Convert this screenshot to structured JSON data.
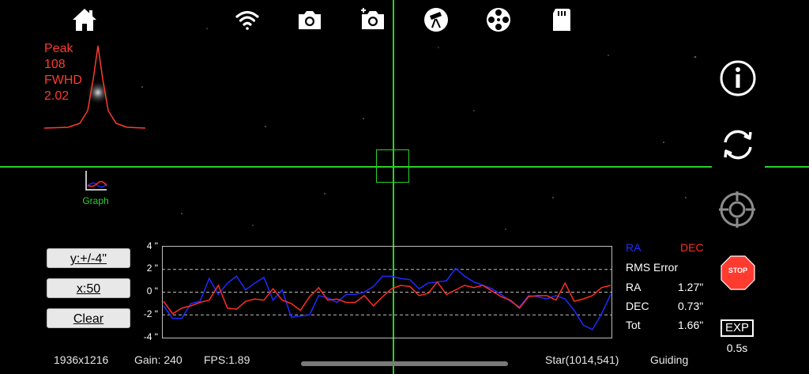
{
  "toolbar": {
    "icons": [
      "home-icon",
      "wifi-icon",
      "camera-icon",
      "camera-settings-icon",
      "telescope-icon",
      "filter-wheel-icon",
      "sd-card-icon",
      "more-icon"
    ]
  },
  "star_profile": {
    "peak_label": "Peak",
    "peak_value": "108",
    "fwhd_label": "FWHD",
    "fwhd_value": "2.02"
  },
  "graph_toggle": {
    "label": "Graph"
  },
  "controls": {
    "y_scale": "y:+/-4\"",
    "x_scale": "x:50",
    "clear": "Clear"
  },
  "chart_data": {
    "type": "line",
    "ylabel": "",
    "ylim": [
      -4,
      4
    ],
    "y_ticks": [
      "4 \"",
      "2 \"",
      "0 \"",
      "-2 \"",
      "-4 \""
    ],
    "x": [
      1,
      2,
      3,
      4,
      5,
      6,
      7,
      8,
      9,
      10,
      11,
      12,
      13,
      14,
      15,
      16,
      17,
      18,
      19,
      20,
      21,
      22,
      23,
      24,
      25,
      26,
      27,
      28,
      29,
      30,
      31,
      32,
      33,
      34,
      35,
      36,
      37,
      38,
      39,
      40,
      41,
      42,
      43,
      44,
      45,
      46,
      47,
      48,
      49,
      50
    ],
    "series": [
      {
        "name": "RA",
        "color": "#1f2bff",
        "values": [
          -1.2,
          -2.3,
          -2.3,
          -1.0,
          -0.8,
          1.2,
          -0.2,
          0.8,
          1.4,
          0.2,
          0.8,
          1.3,
          -0.7,
          0.2,
          -2.2,
          -2.1,
          -2.0,
          -0.3,
          -0.5,
          -0.9,
          -0.2,
          -0.2,
          0.0,
          0.5,
          1.4,
          1.4,
          1.2,
          1.1,
          0.3,
          0.8,
          0.9,
          1.0,
          2.1,
          1.4,
          0.9,
          0.6,
          0.3,
          -0.2,
          -0.8,
          -1.3,
          -0.3,
          -0.4,
          -0.6,
          -0.3,
          -0.6,
          -1.6,
          -2.9,
          -3.3,
          -1.9,
          -0.2
        ]
      },
      {
        "name": "DEC",
        "color": "#ff2d21",
        "values": [
          -0.8,
          -1.9,
          -1.4,
          -1.2,
          -0.9,
          -0.7,
          0.6,
          -1.4,
          -1.5,
          -0.8,
          -0.6,
          -0.7,
          0.3,
          -0.7,
          -1.0,
          -1.6,
          -0.4,
          0.4,
          -0.7,
          -0.6,
          -0.9,
          -0.9,
          -0.3,
          -1.2,
          -0.4,
          0.3,
          0.6,
          0.5,
          -0.3,
          -0.1,
          0.9,
          -0.2,
          0.2,
          0.6,
          0.4,
          0.6,
          0.1,
          -0.4,
          -0.7,
          -1.4,
          -0.4,
          -0.3,
          -0.3,
          -0.7,
          0.8,
          -0.8,
          -0.6,
          -0.3,
          0.4,
          0.6
        ]
      }
    ]
  },
  "rms": {
    "ra_label": "RA",
    "dec_label": "DEC",
    "title": "RMS Error",
    "rows": [
      {
        "label": "RA",
        "value": "1.27\""
      },
      {
        "label": "DEC",
        "value": "0.73\""
      },
      {
        "label": "Tot",
        "value": "1.66\""
      }
    ]
  },
  "status": {
    "resolution": "1936x1216",
    "gain": "Gain: 240",
    "fps": "FPS:1.89",
    "star": "Star(1014,541)",
    "state": "Guiding"
  },
  "side": {
    "stop_label": "STOP",
    "exp_label": "EXP",
    "exp_value": "0.5s"
  },
  "colors": {
    "crosshair": "#2bd12b",
    "profile": "#ff3b30",
    "ra": "#1f2bff",
    "dec": "#ff2d21"
  }
}
